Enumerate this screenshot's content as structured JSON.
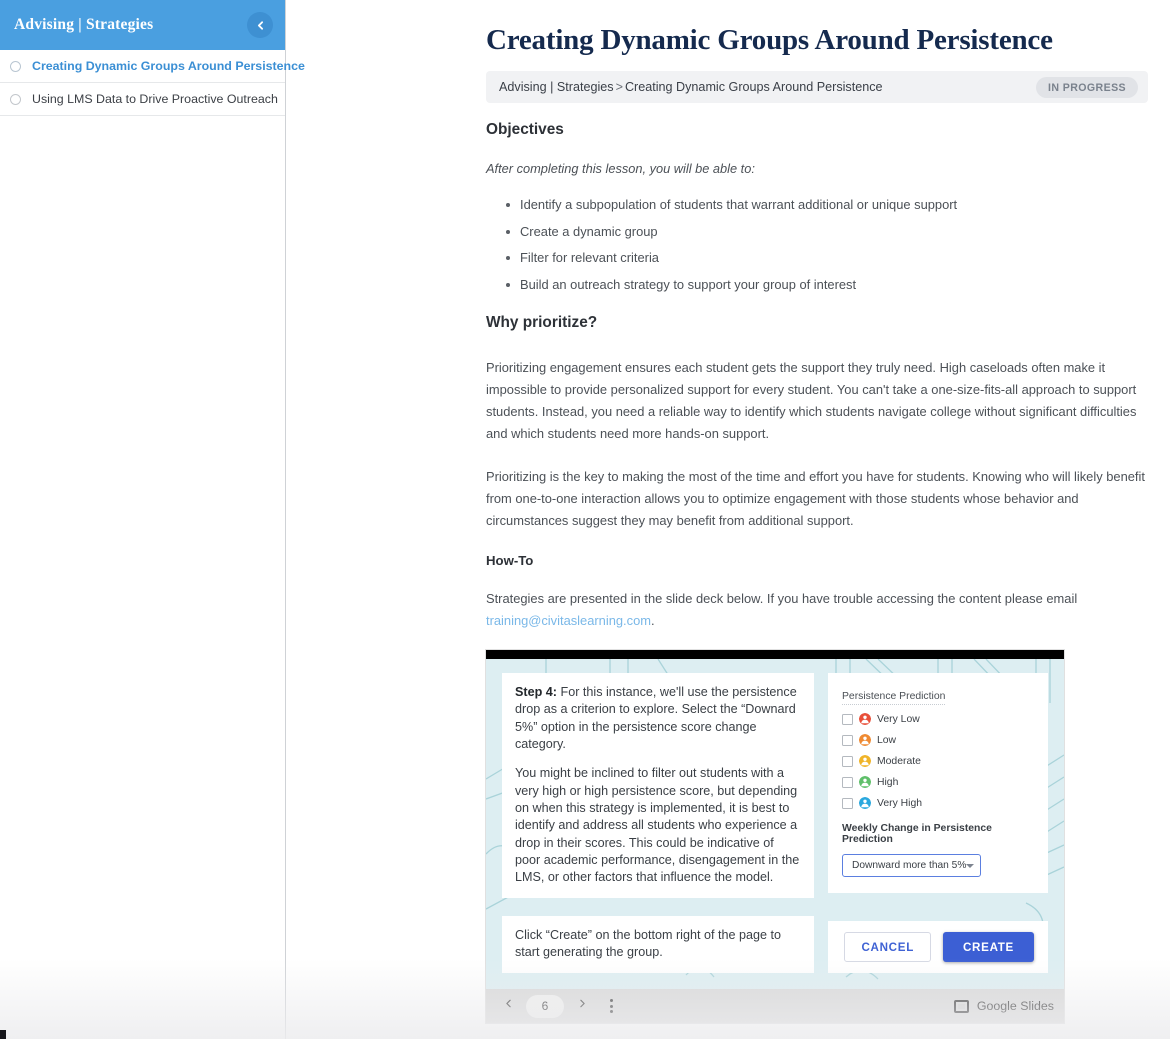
{
  "sidebar": {
    "title": "Advising | Strategies",
    "back_icon": "chevron-left-icon",
    "items": [
      {
        "label": "Creating Dynamic Groups Around Persistence",
        "active": true
      },
      {
        "label": "Using LMS Data to Drive Proactive Outreach",
        "active": false
      }
    ]
  },
  "header": {
    "title": "Creating Dynamic Groups Around Persistence",
    "breadcrumb_parent": "Advising | Strategies",
    "breadcrumb_separator": ">",
    "breadcrumb_current": "Creating Dynamic Groups Around Persistence",
    "status": "IN PROGRESS"
  },
  "objectives": {
    "heading": "Objectives",
    "intro": "After completing this lesson, you will be able to:",
    "items": [
      "Identify a subpopulation of students that warrant additional or unique support",
      "Create a dynamic group",
      "Filter for relevant criteria",
      "Build an outreach strategy to support your group of interest"
    ]
  },
  "why": {
    "heading": "Why prioritize?",
    "p1": "Prioritizing engagement ensures each student gets the support they truly need. High caseloads often make it impossible to provide personalized support for every student. You can't take a one-size-fits-all approach to support students. Instead, you need a reliable way to identify which students navigate college without significant difficulties and which students need more hands-on support.",
    "p2": "Prioritizing is the key to making the most of the time and effort you have for students. Knowing who will likely benefit from one-to-one interaction allows you to optimize engagement with those students whose behavior and circumstances suggest they may benefit from additional support."
  },
  "howto": {
    "heading": "How-To",
    "text_before_link": "Strategies are presented in the slide deck below. If you have trouble accessing the content please email ",
    "link_text": "training@civitaslearning.com",
    "text_after_link": "."
  },
  "slide": {
    "step_label": "Step 4:",
    "step_text": " For this instance, we'll use the persistence drop as a criterion to explore. Select the “Downard 5%” option in the persistence score change category.",
    "paragraph2": "You might be inclined to filter out students with a very high or high persistence score, but depending on when this strategy is implemented, it is best to identify and address all students who experience a drop in their scores. This could be indicative of poor academic performance, disengagement in the LMS, or other factors that influence the model.",
    "lower_note": "Click “Create” on the bottom right of the page to start generating the group.",
    "panel": {
      "label": "Persistence Prediction",
      "options": [
        {
          "label": "Very Low",
          "color": "#e8503a",
          "checked": false
        },
        {
          "label": "Low",
          "color": "#ef8a32",
          "checked": false
        },
        {
          "label": "Moderate",
          "color": "#f0b429",
          "checked": false
        },
        {
          "label": "High",
          "color": "#5fbf6a",
          "checked": false
        },
        {
          "label": "Very High",
          "color": "#2aa8de",
          "checked": false
        }
      ],
      "weekly_change_label": "Weekly Change in Persistence Prediction",
      "select_value": "Downward more than 5%",
      "select_icon": "chevron-down-icon"
    },
    "buttons": {
      "cancel": "CANCEL",
      "create": "CREATE"
    }
  },
  "deck_toolbar": {
    "prev_icon": "chevron-left-icon",
    "next_icon": "chevron-right-icon",
    "page": "6",
    "menu_icon": "kebab-menu-icon",
    "brand_icon": "presentation-icon",
    "brand": "Google Slides"
  },
  "colors": {
    "sidebar_header": "#4a9fe0",
    "accent_link": "#3b8fd4",
    "title": "#152a4e",
    "create_button": "#3c5fd4"
  }
}
